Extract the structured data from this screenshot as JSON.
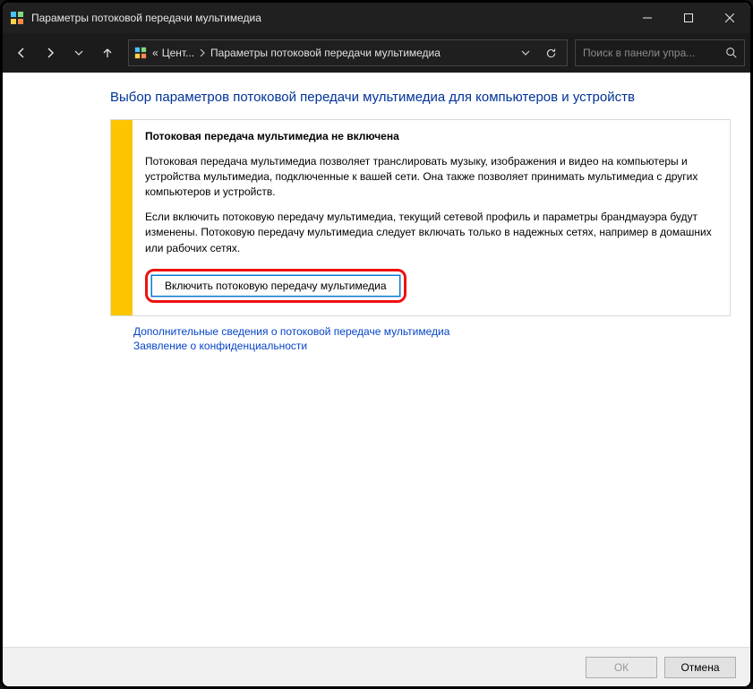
{
  "titlebar": {
    "title": "Параметры потоковой передачи мультимедиа"
  },
  "toolbar": {
    "breadcrumb": {
      "prefix": "«",
      "part1": "Цент...",
      "part2": "Параметры потоковой передачи мультимедиа"
    },
    "search_placeholder": "Поиск в панели упра..."
  },
  "page": {
    "title": "Выбор параметров потоковой передачи мультимедиа для компьютеров и устройств",
    "info_heading": "Потоковая передача мультимедиа не включена",
    "info_para1": "Потоковая передача мультимедиа позволяет транслировать музыку, изображения и видео на компьютеры и устройства мультимедиа, подключенные к вашей сети. Она также позволяет принимать мультимедиа с других компьютеров и устройств.",
    "info_para2": "Если включить потоковую передачу мультимедиа, текущий сетевой профиль и параметры брандмауэра будут изменены. Потоковую передачу мультимедиа следует включать только в надежных сетях, например в домашних или рабочих сетях.",
    "enable_button": "Включить потоковую передачу мультимедиа",
    "link_more": "Дополнительные сведения о потоковой передаче мультимедиа",
    "link_privacy": "Заявление о конфиденциальности"
  },
  "footer": {
    "ok": "ОК",
    "cancel": "Отмена"
  }
}
